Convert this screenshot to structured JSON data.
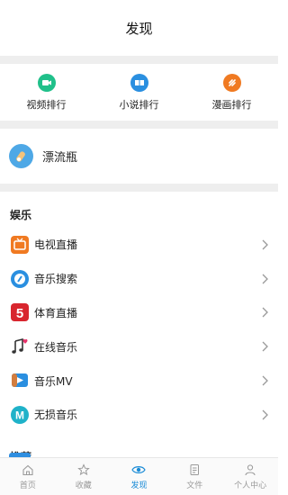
{
  "header": {
    "title": "发现"
  },
  "rankings": [
    {
      "label": "视频排行",
      "icon": "video-icon",
      "color": "#20c08a"
    },
    {
      "label": "小说排行",
      "icon": "book-icon",
      "color": "#2a8fe0"
    },
    {
      "label": "漫画排行",
      "icon": "comic-icon",
      "color": "#f07a22"
    }
  ],
  "bottle": {
    "label": "漂流瓶",
    "icon": "drift-bottle-icon"
  },
  "entertainment": {
    "title": "娱乐",
    "items": [
      {
        "label": "电视直播",
        "icon": "tv-icon"
      },
      {
        "label": "音乐搜索",
        "icon": "music-search-icon"
      },
      {
        "label": "体育直播",
        "icon": "sports-icon"
      },
      {
        "label": "在线音乐",
        "icon": "music-note-icon"
      },
      {
        "label": "音乐MV",
        "icon": "music-mv-icon"
      },
      {
        "label": "无损音乐",
        "icon": "lossless-music-icon"
      }
    ]
  },
  "recommend": {
    "title": "推荐"
  },
  "tabbar": {
    "tabs": [
      {
        "label": "首页",
        "icon": "home-icon"
      },
      {
        "label": "收藏",
        "icon": "star-icon"
      },
      {
        "label": "发现",
        "icon": "eye-icon",
        "active": true
      },
      {
        "label": "文件",
        "icon": "file-icon"
      },
      {
        "label": "个人中心",
        "icon": "user-icon"
      }
    ]
  }
}
